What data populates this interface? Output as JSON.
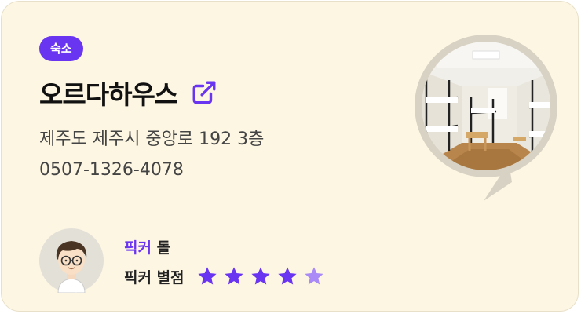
{
  "card": {
    "category_badge": "숙소",
    "place_name": "오르다하우스",
    "address": "제주도 제주시 중앙로 192 3층",
    "phone": "0507-1326-4078"
  },
  "picker": {
    "name_prefix": "픽커",
    "name": "돌",
    "rating_label": "픽커 별점",
    "rating": 4.5,
    "rating_max": 5
  },
  "colors": {
    "accent": "#6a35f0",
    "card_bg": "#fdf6e3",
    "star_full": "#6a35f0",
    "star_half": "#a98af7"
  },
  "icons": {
    "external_link": "external-link-icon",
    "star": "star-icon"
  }
}
